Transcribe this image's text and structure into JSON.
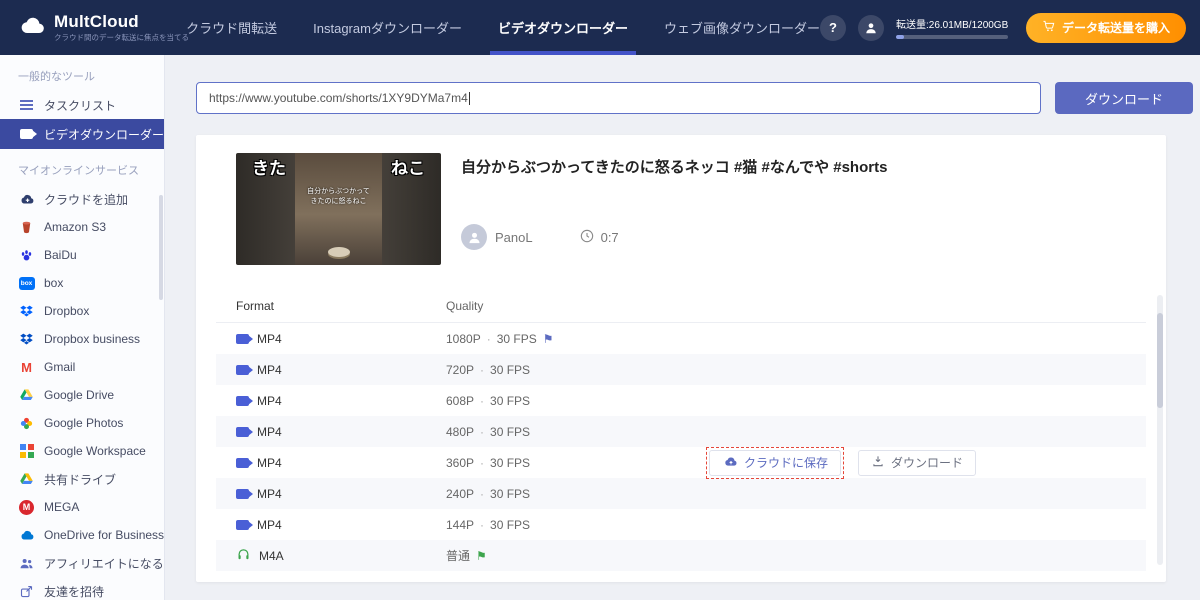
{
  "colors": {
    "accent": "#5c6bc0",
    "header_bg": "#1c2b50",
    "active_nav_underline": "#4353c8",
    "orange_button": "#ff9800",
    "dashed_highlight": "#e5473a",
    "green": "#3da54d"
  },
  "header": {
    "brand": {
      "name": "MultCloud",
      "tagline": "クラウド間のデータ転送に焦点を当てる"
    },
    "nav": [
      {
        "label": "クラウド間転送"
      },
      {
        "label": "Instagramダウンローダー"
      },
      {
        "label": "ビデオダウンローダー"
      },
      {
        "label": "ウェブ画像ダウンローダー"
      }
    ],
    "usage_label": "転送量:26.01MB/1200GB",
    "buy_button_label": "データ転送量を購入"
  },
  "sidebar": {
    "sections": [
      {
        "title": "一般的なツール",
        "items": [
          {
            "label": "タスクリスト",
            "icon": "task-list"
          },
          {
            "label": "ビデオダウンローダー",
            "icon": "video-downloader",
            "active": true
          }
        ]
      },
      {
        "title": "マイオンラインサービス",
        "items": [
          {
            "label": "クラウドを追加",
            "icon": "add-cloud"
          },
          {
            "label": "Amazon S3",
            "icon": "amazon-s3"
          },
          {
            "label": "BaiDu",
            "icon": "baidu"
          },
          {
            "label": "box",
            "icon": "box"
          },
          {
            "label": "Dropbox",
            "icon": "dropbox"
          },
          {
            "label": "Dropbox business",
            "icon": "dropbox-business"
          },
          {
            "label": "Gmail",
            "icon": "gmail"
          },
          {
            "label": "Google Drive",
            "icon": "google-drive"
          },
          {
            "label": "Google Photos",
            "icon": "google-photos"
          },
          {
            "label": "Google Workspace",
            "icon": "google-workspace"
          },
          {
            "label": "共有ドライブ",
            "icon": "shared-drive"
          },
          {
            "label": "MEGA",
            "icon": "mega"
          },
          {
            "label": "OneDrive for Business",
            "icon": "onedrive"
          },
          {
            "label": "アフィリエイトになる",
            "icon": "affiliate"
          },
          {
            "label": "友達を招待",
            "icon": "invite-friends"
          }
        ]
      }
    ]
  },
  "main": {
    "url_input_value": "https://www.youtube.com/shorts/1XY9DYMa7m4",
    "download_button_label": "ダウンロード",
    "video": {
      "title": "自分からぶつかってきたのに怒るネッコ #猫 #なんでや #shorts",
      "author": "PanoL",
      "duration": "0:7",
      "thumbnail_text_left": "きた",
      "thumbnail_text_right": "ねこ",
      "thumbnail_caption_line1": "自分からぶつかって",
      "thumbnail_caption_line2": "きたのに怒るねこ"
    },
    "table": {
      "columns": {
        "format": "Format",
        "quality": "Quality"
      },
      "dot": "·",
      "rows": [
        {
          "format": "MP4",
          "quality": "1080P",
          "fps": "30 FPS",
          "flag": "blue"
        },
        {
          "format": "MP4",
          "quality": "720P",
          "fps": "30 FPS"
        },
        {
          "format": "MP4",
          "quality": "608P",
          "fps": "30 FPS"
        },
        {
          "format": "MP4",
          "quality": "480P",
          "fps": "30 FPS"
        },
        {
          "format": "MP4",
          "quality": "360P",
          "fps": "30 FPS",
          "has_actions": true
        },
        {
          "format": "MP4",
          "quality": "240P",
          "fps": "30 FPS"
        },
        {
          "format": "MP4",
          "quality": "144P",
          "fps": "30 FPS"
        },
        {
          "format": "M4A",
          "quality": "普通",
          "flag": "green"
        }
      ],
      "save_to_cloud_label": "クラウドに保存",
      "row_download_label": "ダウンロード"
    }
  }
}
